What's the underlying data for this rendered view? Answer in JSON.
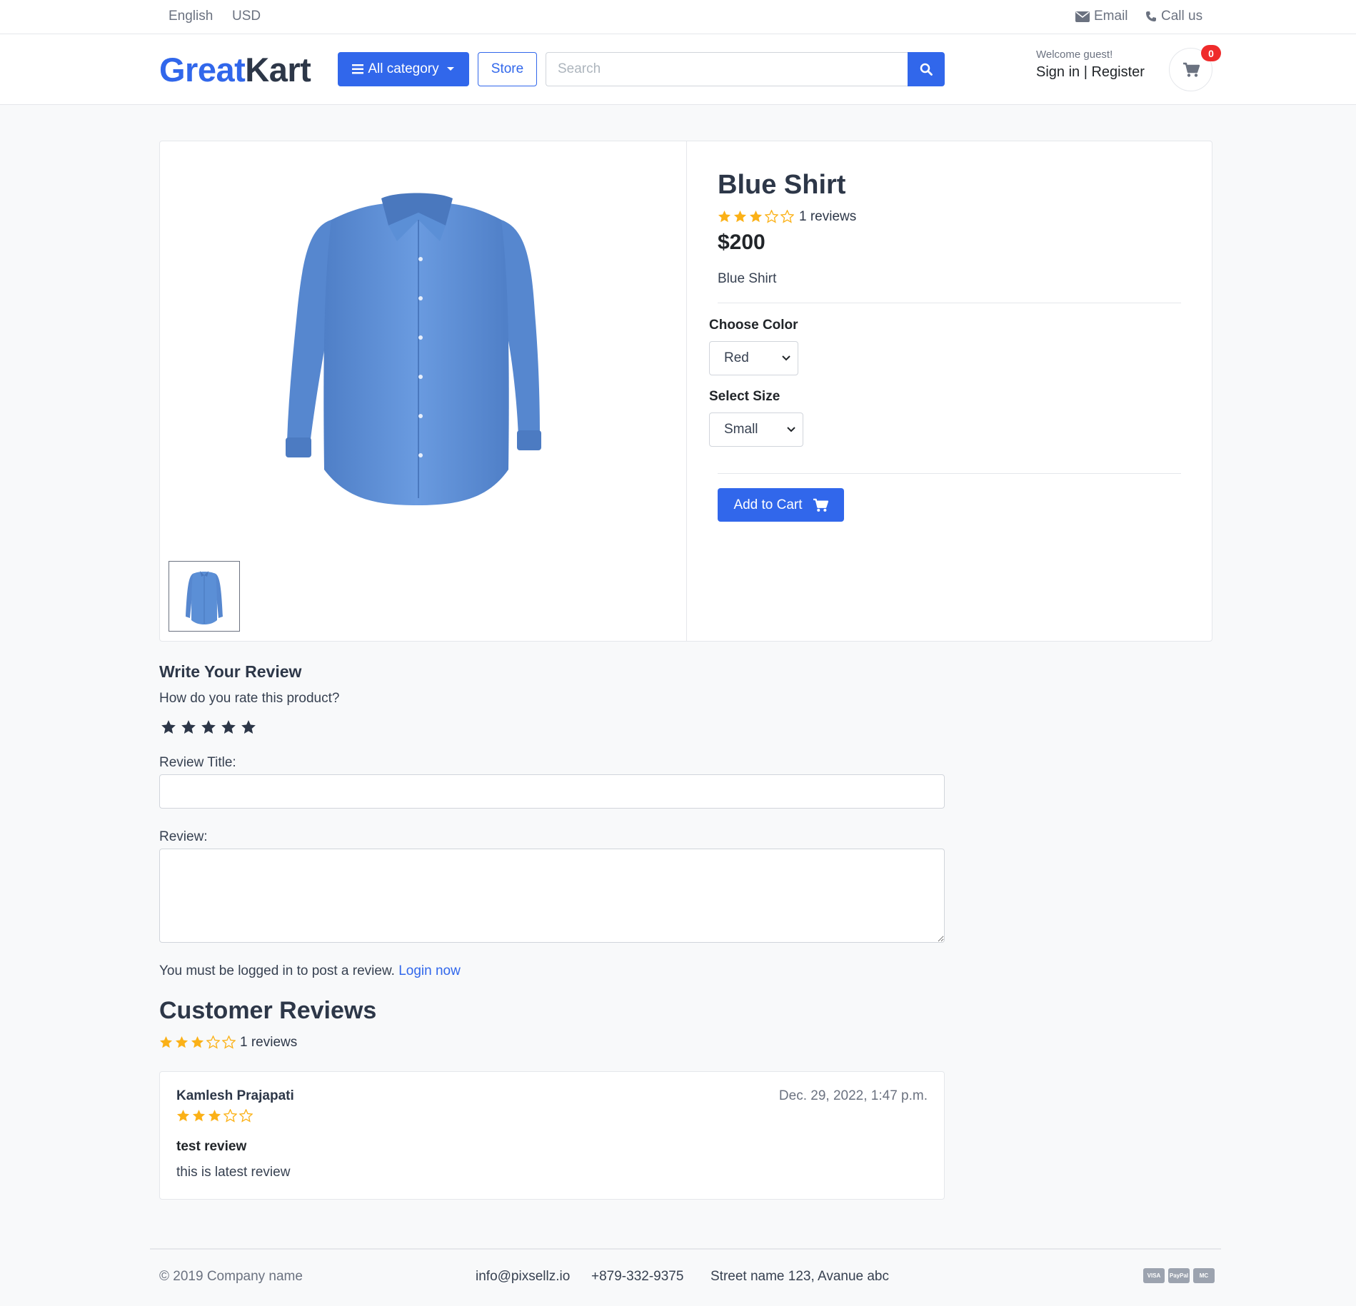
{
  "topbar": {
    "language": "English",
    "currency": "USD",
    "email": "Email",
    "call": "Call us"
  },
  "header": {
    "logo_part1": "Great",
    "logo_part2": "Kart",
    "category_button": "All category",
    "store_button": "Store",
    "search_placeholder": "Search",
    "welcome": "Welcome guest!",
    "sign_in": "Sign in",
    "separator": "|",
    "register": "Register",
    "cart_count": "0"
  },
  "product": {
    "title": "Blue Shirt",
    "rating": 3,
    "rating_max": 5,
    "reviews_label": "1 reviews",
    "price": "$200",
    "description": "Blue Shirt",
    "color_label": "Choose Color",
    "color_selected": "Red",
    "size_label": "Select Size",
    "size_selected": "Small",
    "add_to_cart": "Add to Cart"
  },
  "review_form": {
    "heading": "Write Your Review",
    "question": "How do you rate this product?",
    "title_label": "Review Title:",
    "review_label": "Review:",
    "must_login": "You must be logged in to post a review.",
    "login_link": "Login now"
  },
  "customer_reviews": {
    "heading": "Customer Reviews",
    "rating": 3,
    "count_label": "1 reviews",
    "items": [
      {
        "name": "Kamlesh Prajapati",
        "date": "Dec. 29, 2022, 1:47 p.m.",
        "rating": 3,
        "title": "test review",
        "body": "this is latest review"
      }
    ]
  },
  "footer": {
    "copyright": "© 2019 Company name",
    "email": "info@pixsellz.io",
    "phone": "+879-332-9375",
    "address": "Street name 123, Avanue abc",
    "payments": [
      "VISA",
      "PayPal",
      "MC"
    ]
  },
  "colors": {
    "primary": "#3167eb",
    "star": "#fbb117",
    "badge": "#ef2b2b",
    "shirt": "#5b8fd6"
  }
}
